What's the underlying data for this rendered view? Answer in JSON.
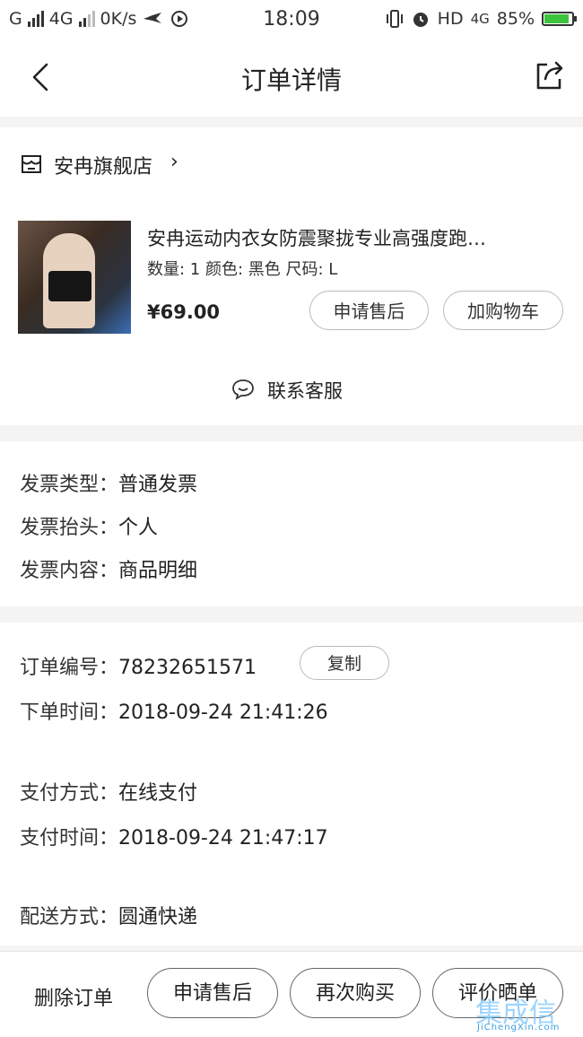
{
  "status_bar": {
    "carrier": "G",
    "network": "4G",
    "speed": "0K/s",
    "time": "18:09",
    "hd": "HD",
    "net2": "4G",
    "battery_pct": "85%",
    "battery_level": 0.85
  },
  "nav": {
    "title": "订单详情",
    "back_icon": "chevron-left-icon",
    "share_icon": "share-icon"
  },
  "store": {
    "name": "安冉旗舰店",
    "chevron": "›"
  },
  "product": {
    "title": "安冉运动内衣女防震聚拢专业高强度跑…",
    "specs": "数量: 1 颜色: 黑色 尺码: L",
    "price": "¥69.00",
    "after_sale_label": "申请售后",
    "add_cart_label": "加购物车"
  },
  "service": {
    "label": "联系客服"
  },
  "invoice": {
    "type_key": "发票类型：",
    "type_val": "普通发票",
    "title_key": "发票抬头：",
    "title_val": "个人",
    "content_key": "发票内容：",
    "content_val": "商品明细"
  },
  "order": {
    "number_key": "订单编号：",
    "number_val": "78232651571",
    "copy_label": "复制",
    "time_key": "下单时间：",
    "time_val": "2018-09-24 21:41:26"
  },
  "payment": {
    "method_key": "支付方式：",
    "method_val": "在线支付",
    "time_key": "支付时间：",
    "time_val": "2018-09-24 21:47:17"
  },
  "shipping": {
    "method_key": "配送方式：",
    "method_val": "圆通快递"
  },
  "bottom": {
    "delete_label": "删除订单",
    "after_sale_label": "申请售后",
    "rebuy_label": "再次购买",
    "review_label": "评价晒单"
  },
  "watermark": {
    "cn": "集成信",
    "en": "JiChengXin.com"
  },
  "colors": {
    "battery_fill": "#3cc43c",
    "divider_bg": "#f4f4f4"
  }
}
